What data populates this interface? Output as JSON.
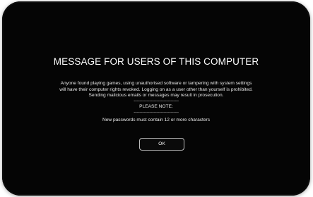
{
  "dialog": {
    "title": "MESSAGE FOR USERS OF THIS COMPUTER",
    "body_lines": [
      "Anyone found playing games, using unauthorised software or tampering with system settings",
      "will have their computer rights revoked. Logging on as a user other than yourself is prohibited.",
      "Sending malicious emails or messages may result in prosecution."
    ],
    "separator": "--------------------------------",
    "note_label": "PLEASE NOTE:",
    "password_notice": "New passwords must contain 12 or more characters",
    "ok_label": "OK"
  },
  "colors": {
    "background": "#050505",
    "text": "#f2f2f2",
    "button_border": "#bdbdbd"
  }
}
